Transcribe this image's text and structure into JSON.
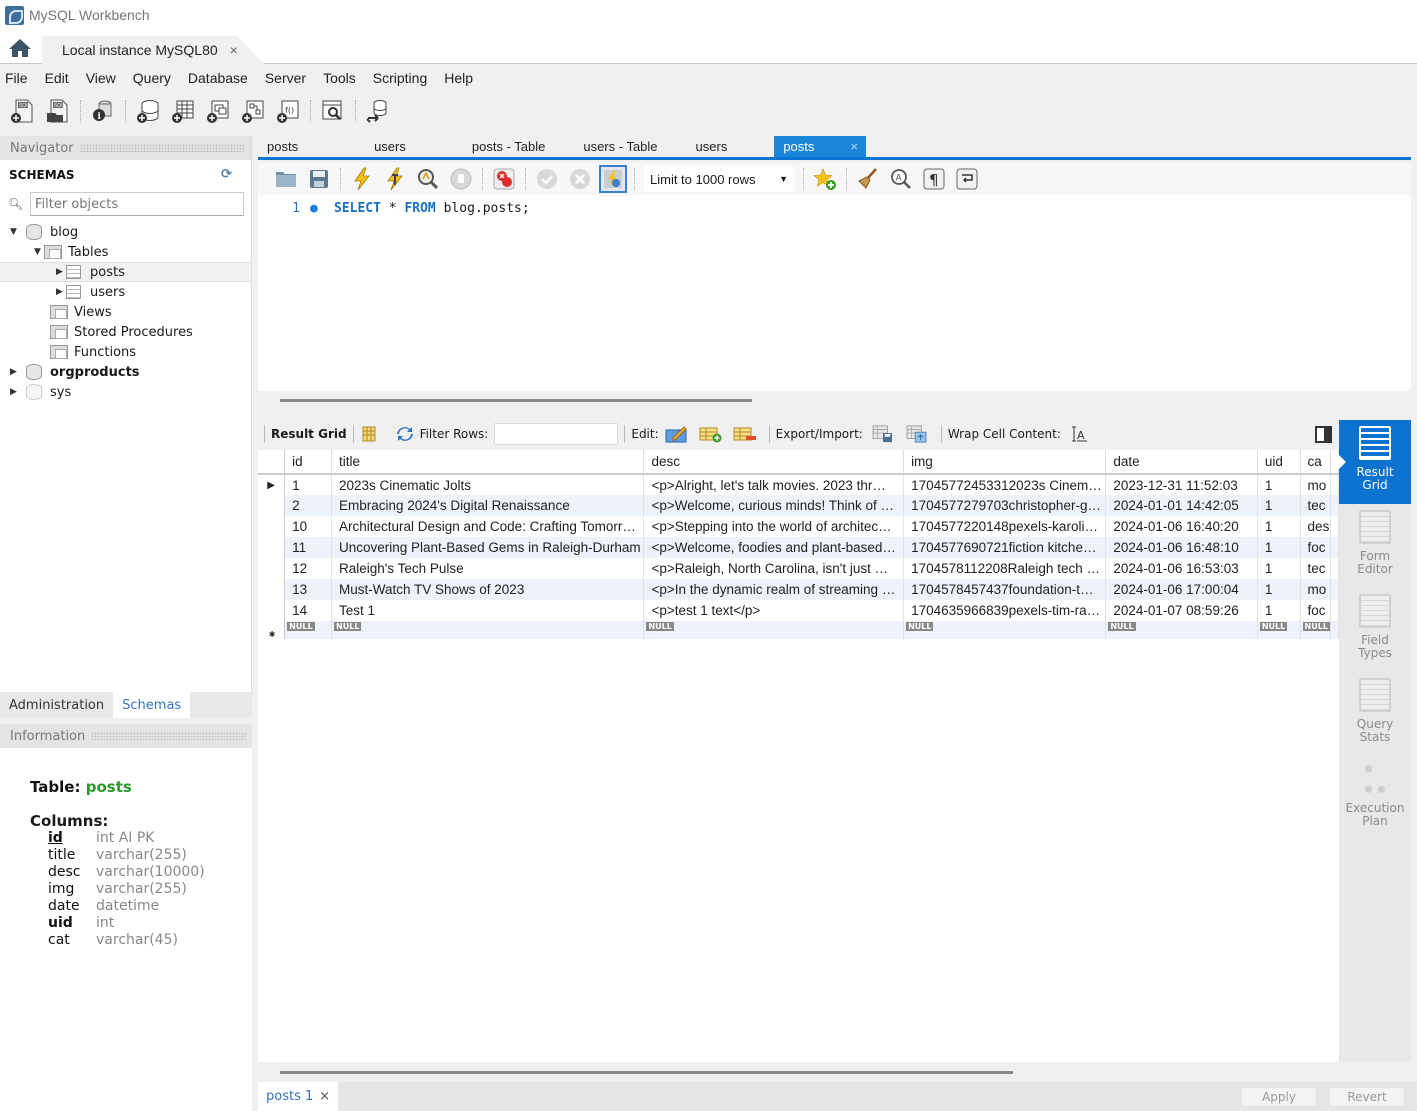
{
  "app": {
    "title": "MySQL Workbench"
  },
  "connection_tab": {
    "label": "Local instance MySQL80",
    "close": "×"
  },
  "menu": [
    "File",
    "Edit",
    "View",
    "Query",
    "Database",
    "Server",
    "Tools",
    "Scripting",
    "Help"
  ],
  "main_toolbar": [
    "new-sql-tab-icon",
    "open-sql-script-icon",
    "inspector-icon",
    "create-schema-icon",
    "create-table-icon",
    "create-view-icon",
    "create-procedure-icon",
    "create-function-icon",
    "search-table-data-icon",
    "reconnect-icon"
  ],
  "navigator": {
    "title": "Navigator",
    "schemas_label": "SCHEMAS",
    "filter_placeholder": "Filter objects",
    "tree": {
      "blog": "blog",
      "tables": "Tables",
      "posts": "posts",
      "users": "users",
      "views": "Views",
      "procedures": "Stored Procedures",
      "functions": "Functions",
      "orgproducts": "orgproducts",
      "sys": "sys"
    }
  },
  "bottom_tabs": {
    "administration": "Administration",
    "schemas": "Schemas"
  },
  "information": {
    "title": "Information",
    "table_label": "Table:",
    "table_name": "posts",
    "columns_label": "Columns:",
    "columns": [
      {
        "name": "id",
        "type": "int AI PK"
      },
      {
        "name": "title",
        "type": "varchar(255)"
      },
      {
        "name": "desc",
        "type": "varchar(10000)"
      },
      {
        "name": "img",
        "type": "varchar(255)"
      },
      {
        "name": "date",
        "type": "datetime"
      },
      {
        "name": "uid",
        "type": "int"
      },
      {
        "name": "cat",
        "type": "varchar(45)"
      }
    ]
  },
  "editor_tabs": [
    {
      "label": "posts"
    },
    {
      "label": "users"
    },
    {
      "label": "posts - Table"
    },
    {
      "label": "users - Table"
    },
    {
      "label": "users"
    },
    {
      "label": "posts",
      "active": true,
      "close": "×"
    }
  ],
  "sql_toolbar": {
    "limit": "Limit to 1000 rows"
  },
  "sql": {
    "line": "1",
    "keyword1": "SELECT",
    "star": " * ",
    "keyword2": "FROM",
    "rest": " blog.posts;"
  },
  "result_toolbar": {
    "result_grid": "Result Grid",
    "filter_rows": "Filter Rows:",
    "edit": "Edit:",
    "export_import": "Export/Import:",
    "wrap": "Wrap Cell Content:"
  },
  "grid": {
    "columns": [
      "id",
      "title",
      "desc",
      "img",
      "date",
      "uid",
      "ca"
    ],
    "rows": [
      [
        "1",
        "2023s Cinematic Jolts",
        "<p>Alright, let's talk movies. 2023 thr…",
        "17045772453312023s Cinem…",
        "2023-12-31 11:52:03",
        "1",
        "mo"
      ],
      [
        "2",
        "Embracing 2024's Digital Renaissance",
        "<p>Welcome, curious minds! Think of …",
        "1704577279703christopher-g…",
        "2024-01-01 14:42:05",
        "1",
        "tec"
      ],
      [
        "10",
        "Architectural Design and Code: Crafting Tomorr…",
        "<p>Stepping into the world of architec…",
        "1704577220148pexels-karoli…",
        "2024-01-06 16:40:20",
        "1",
        "des"
      ],
      [
        "11",
        "Uncovering Plant-Based Gems in Raleigh-Durham",
        "<p>Welcome, foodies and plant-based…",
        "1704577690721fiction kitche…",
        "2024-01-06 16:48:10",
        "1",
        "foc"
      ],
      [
        "12",
        "Raleigh's Tech Pulse",
        "<p>Raleigh, North Carolina, isn't just …",
        "1704578112208Raleigh tech …",
        "2024-01-06 16:53:03",
        "1",
        "tec"
      ],
      [
        "13",
        "Must-Watch TV Shows of 2023",
        "<p>In the dynamic realm of streaming …",
        "1704578457437foundation-t…",
        "2024-01-06 17:00:04",
        "1",
        "mo"
      ],
      [
        "14",
        "Test 1",
        "<p>test 1 text</p>",
        "1704635966839pexels-tim-ra…",
        "2024-01-07 08:59:26",
        "1",
        "foc"
      ]
    ],
    "null_label": "NULL"
  },
  "side_panel": [
    {
      "label1": "Result",
      "label2": "Grid",
      "active": true
    },
    {
      "label1": "Form",
      "label2": "Editor"
    },
    {
      "label1": "Field",
      "label2": "Types"
    },
    {
      "label1": "Query",
      "label2": "Stats"
    },
    {
      "label1": "Execution",
      "label2": "Plan"
    }
  ],
  "status": {
    "result_tab": "posts 1",
    "close": "×",
    "apply": "Apply",
    "revert": "Revert"
  },
  "colors": {
    "accent": "#0b72cf",
    "tab_active": "#1a86d9",
    "table_name": "#2a9a2a",
    "link": "#3574c4"
  }
}
